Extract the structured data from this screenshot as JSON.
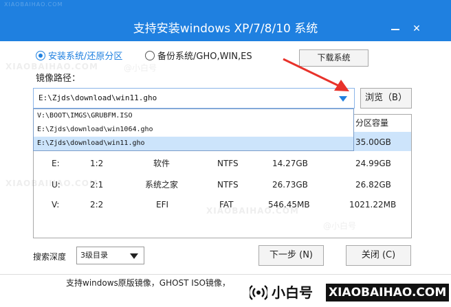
{
  "window": {
    "title": "支持安装windows XP/7/8/10 系统",
    "minimize_icon": "minimize-icon",
    "close_icon": "close-icon",
    "close_glyph": "✕"
  },
  "mode": {
    "install_label": "安装系统/还原分区",
    "install_selected": true,
    "backup_label": "备份系统/GHO,WIN,ES",
    "backup_selected": false
  },
  "toolbar": {
    "download_label": "下载系统"
  },
  "image_path": {
    "label": "镜像路径：",
    "value": "E:\\Zjds\\download\\win11.gho",
    "browse_label": "浏览（B）",
    "options": [
      "V:\\BOOT\\IMGS\\GRUBFM.ISO",
      "E:\\Zjds\\download\\win1064.gho",
      "E:\\Zjds\\download\\win11.gho"
    ],
    "selected_index": 2
  },
  "partitions": {
    "headers": {
      "capacity": "分区容量"
    },
    "rows": [
      {
        "drive": "",
        "index": "",
        "label": "",
        "fs": "",
        "free": "",
        "capacity": "35.00GB",
        "selected": true
      },
      {
        "drive": "E:",
        "index": "1:2",
        "label": "软件",
        "fs": "NTFS",
        "free": "14.27GB",
        "capacity": "24.99GB",
        "selected": false
      },
      {
        "drive": "U:",
        "index": "2:1",
        "label": "系统之家",
        "fs": "NTFS",
        "free": "26.73GB",
        "capacity": "26.82GB",
        "selected": false
      },
      {
        "drive": "V:",
        "index": "2:2",
        "label": "EFI",
        "fs": "FAT",
        "free": "546.45MB",
        "capacity": "1021.22MB",
        "selected": false
      }
    ]
  },
  "search": {
    "label": "搜索深度",
    "value": "3级目录"
  },
  "actions": {
    "next_label": "下一步 (N)",
    "close_label": "关闭 (C)"
  },
  "footer": {
    "text": "支持windows原版镜像，GHOST ISO镜像，"
  },
  "branding": {
    "name_cn": "小白号",
    "name_en": "XIAOBAIHAO.COM",
    "watermark_en": "XIAOBAIHAO.COM",
    "watermark_cn": "@小白号",
    "accent_color": "#1f80e0",
    "arrow_color": "#e8322b"
  }
}
